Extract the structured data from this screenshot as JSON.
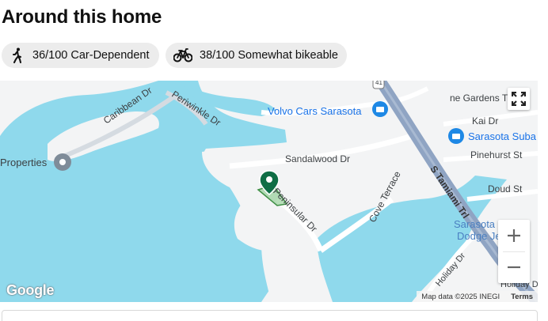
{
  "section": {
    "title": "Around this home"
  },
  "scores": {
    "walk": {
      "icon": "walking-person-icon",
      "label": "36/100 Car-Dependent"
    },
    "bike": {
      "icon": "bicycle-icon",
      "label": "38/100 Somewhat bikeable"
    }
  },
  "map": {
    "colors": {
      "water": "#8fd9ec",
      "land": "#f3f4f5",
      "highway": "#8fa4c3",
      "road": "#ffffff",
      "pin": "#0f6e45",
      "poi": "#1a73e8"
    },
    "labels": {
      "caribbean": "Caribbean Dr",
      "periwinkle": "Periwinkle Dr",
      "properties": "Properties",
      "volvo": "Volvo Cars Sarasota",
      "sandalwood": "Sandalwood Dr",
      "peninsular": "Peninsular Dr",
      "cove": "Cove Terrace",
      "tamiami": "S Tamiami Trl",
      "gardens": "ne Gardens Tra",
      "kai": "Kai Dr",
      "sarasota_suba": "Sarasota Suba",
      "pinehurst": "Pinehurst St",
      "doud": "Doud St",
      "sarasota_dodge_1": "Sarasota",
      "sarasota_dodge_2": "Dodge Je",
      "holiday1": "Holiday Dr",
      "holiday2": "Holiday D",
      "route41": "41",
      "pin_icon": "location-pin-icon"
    },
    "controls": {
      "fullscreen_icon": "fullscreen-icon",
      "zoom_in_icon": "plus-icon",
      "zoom_out_icon": "minus-icon"
    },
    "logo": "Google",
    "attribution": "Map data ©2025 INEGI",
    "terms": "Terms"
  }
}
